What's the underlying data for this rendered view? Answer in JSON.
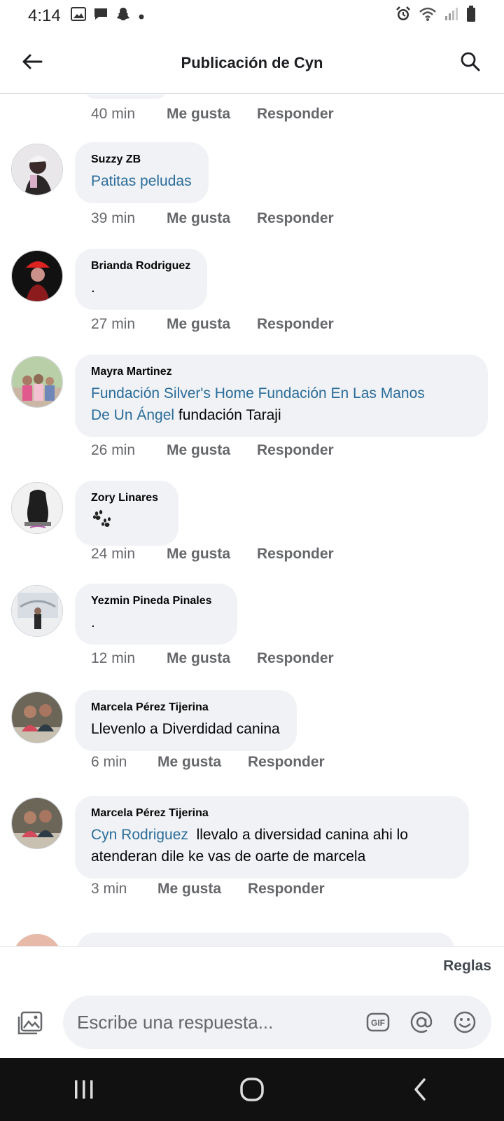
{
  "status_bar": {
    "time": "4:14",
    "left_icons": [
      "image-icon",
      "message-icon",
      "snapchat-icon",
      "dot-icon"
    ],
    "right_icons": [
      "alarm-icon",
      "wifi-icon",
      "signal-icon",
      "battery-icon"
    ]
  },
  "header": {
    "title": "Publicación de Cyn",
    "back_icon": "arrow-left-icon",
    "search_icon": "search-icon"
  },
  "first_action_row": {
    "time": "40 min",
    "like": "Me gusta",
    "reply": "Responder"
  },
  "comments": [
    {
      "author": "Suzzy ZB",
      "segments": [
        {
          "text": "Patitas peludas",
          "link": true
        }
      ],
      "time": "39 min",
      "like": "Me gusta",
      "reply": "Responder"
    },
    {
      "author": "Brianda Rodriguez",
      "segments": [
        {
          "text": ".",
          "link": false
        }
      ],
      "time": "27 min",
      "like": "Me gusta",
      "reply": "Responder"
    },
    {
      "author": "Mayra Martinez",
      "line1": [
        {
          "text": "Fundación Silver's Home Fundación En Las Manos",
          "link": true
        }
      ],
      "line2": [
        {
          "text": "De Un Ángel",
          "link": true
        },
        {
          "text": " fundación Taraji",
          "link": false
        }
      ],
      "time": "26 min",
      "like": "Me gusta",
      "reply": "Responder"
    },
    {
      "author": "Zory Linares",
      "segments": [
        {
          "text": "🐾",
          "link": false
        }
      ],
      "time": "24 min",
      "like": "Me gusta",
      "reply": "Responder"
    },
    {
      "author": "Yezmin Pineda Pinales",
      "segments": [
        {
          "text": ".",
          "link": false
        }
      ],
      "time": "12 min",
      "like": "Me gusta",
      "reply": "Responder"
    },
    {
      "author": "Marcela Pérez Tijerina",
      "segments": [
        {
          "text": "Llevenlo a Diverdidad canina",
          "link": false
        }
      ],
      "time": "6 min",
      "like": "Me gusta",
      "reply": "Responder"
    },
    {
      "author": "Marcela Pérez Tijerina",
      "line1": [
        {
          "text": "Cyn Rodriguez",
          "link": true
        },
        {
          "text": "  llevalo a diversidad canina ahi lo",
          "link": false
        }
      ],
      "line2": [
        {
          "text": "atenderan dile ke vas de oarte de marcela",
          "link": false
        }
      ],
      "time": "3 min",
      "like": "Me gusta",
      "reply": "Responder"
    }
  ],
  "composer": {
    "rules_label": "Reglas",
    "placeholder": "Escribe una respuesta...",
    "icons": [
      "photo-icon",
      "gif-icon",
      "mention-icon",
      "emoji-icon"
    ],
    "gif_label": "GIF"
  },
  "navbar": {
    "icons": [
      "recent-apps-icon",
      "home-icon",
      "back-icon"
    ]
  }
}
